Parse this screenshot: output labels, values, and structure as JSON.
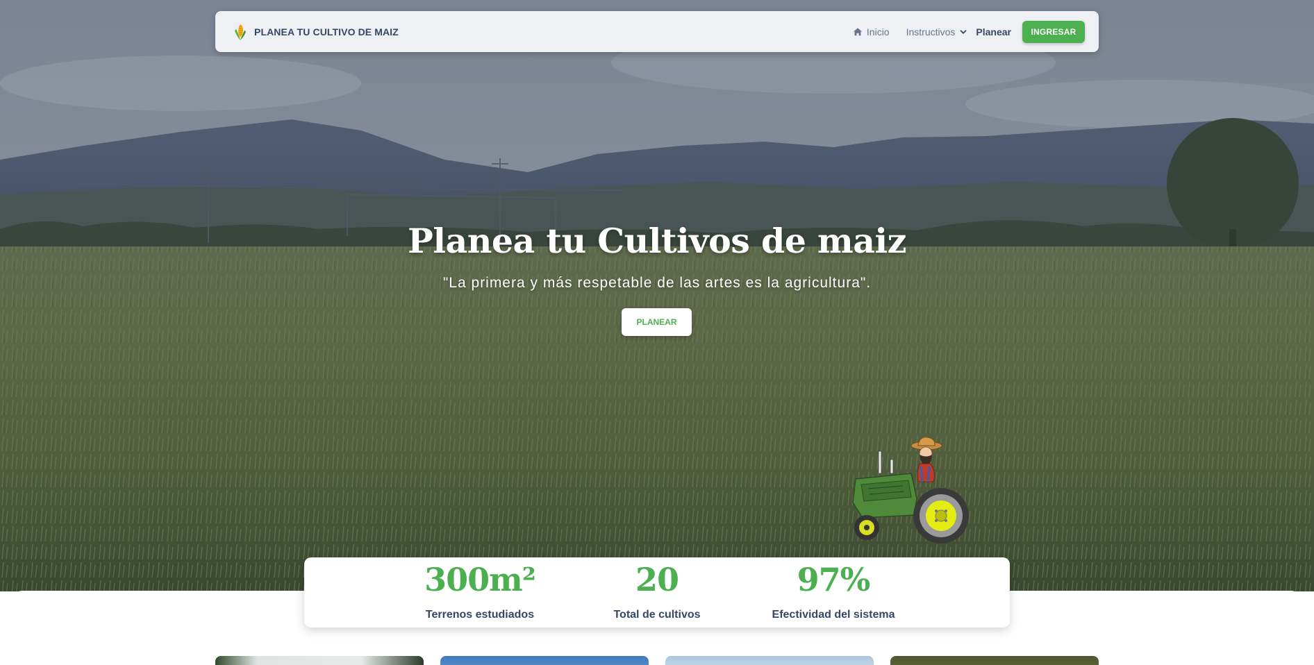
{
  "navbar": {
    "brand": "PLANEA TU CULTIVO DE MAIZ",
    "links": {
      "home": "Inicio",
      "instructivos": "Instructivos",
      "planear": "Planear"
    },
    "login_button": "INGRESAR"
  },
  "hero": {
    "title": "Planea tu Cultivos de maiz",
    "quote": "\"La primera y más respetable de las artes es la agricultura\".",
    "cta_button": "PLANEAR"
  },
  "stats": [
    {
      "value": "300m²",
      "label": "Terrenos estudiados"
    },
    {
      "value": "20",
      "label": "Total de cultivos"
    },
    {
      "value": "97%",
      "label": "Efectividad del sistema"
    }
  ],
  "colors": {
    "primary_green": "#4caf50",
    "heading_dark": "#344767",
    "muted_text": "#67748e"
  },
  "icons": {
    "brand": "corn-icon",
    "home": "home-icon",
    "dropdown": "chevron-down-icon"
  }
}
